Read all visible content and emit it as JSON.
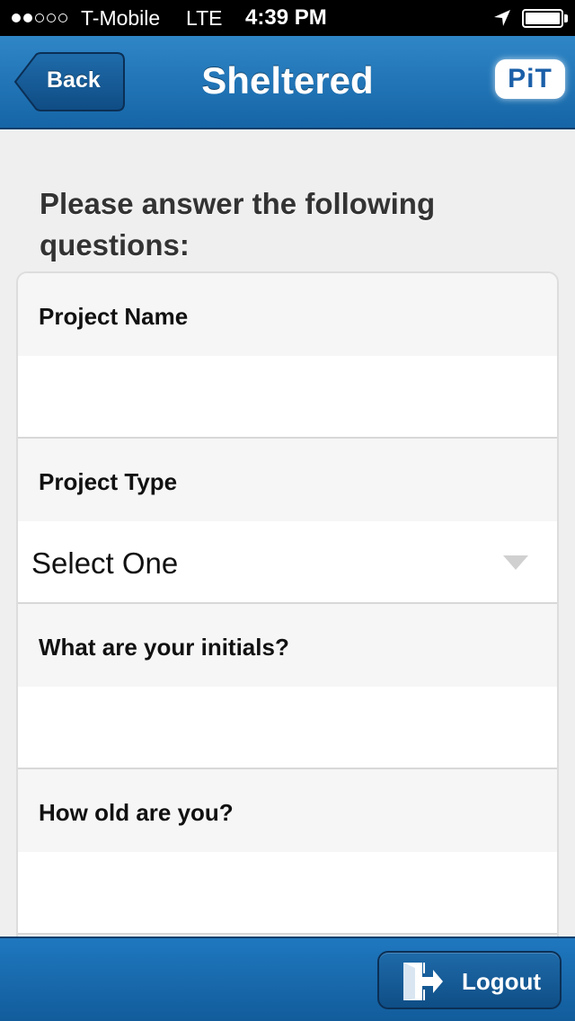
{
  "status_bar": {
    "carrier": "T-Mobile",
    "network": "LTE",
    "time": "4:39 PM"
  },
  "nav": {
    "back_label": "Back",
    "title": "Sheltered",
    "logo_text": "PiT"
  },
  "intro": "Please answer the following questions:",
  "fields": [
    {
      "label": "Project Name",
      "value": ""
    },
    {
      "label": "Project Type",
      "selected": "Select One"
    },
    {
      "label": "What are your initials?",
      "value": ""
    },
    {
      "label": "How old are you?",
      "value": ""
    }
  ],
  "footer": {
    "logout_label": "Logout"
  },
  "colors": {
    "nav_blue": "#1f72b6",
    "background": "#efefef"
  }
}
